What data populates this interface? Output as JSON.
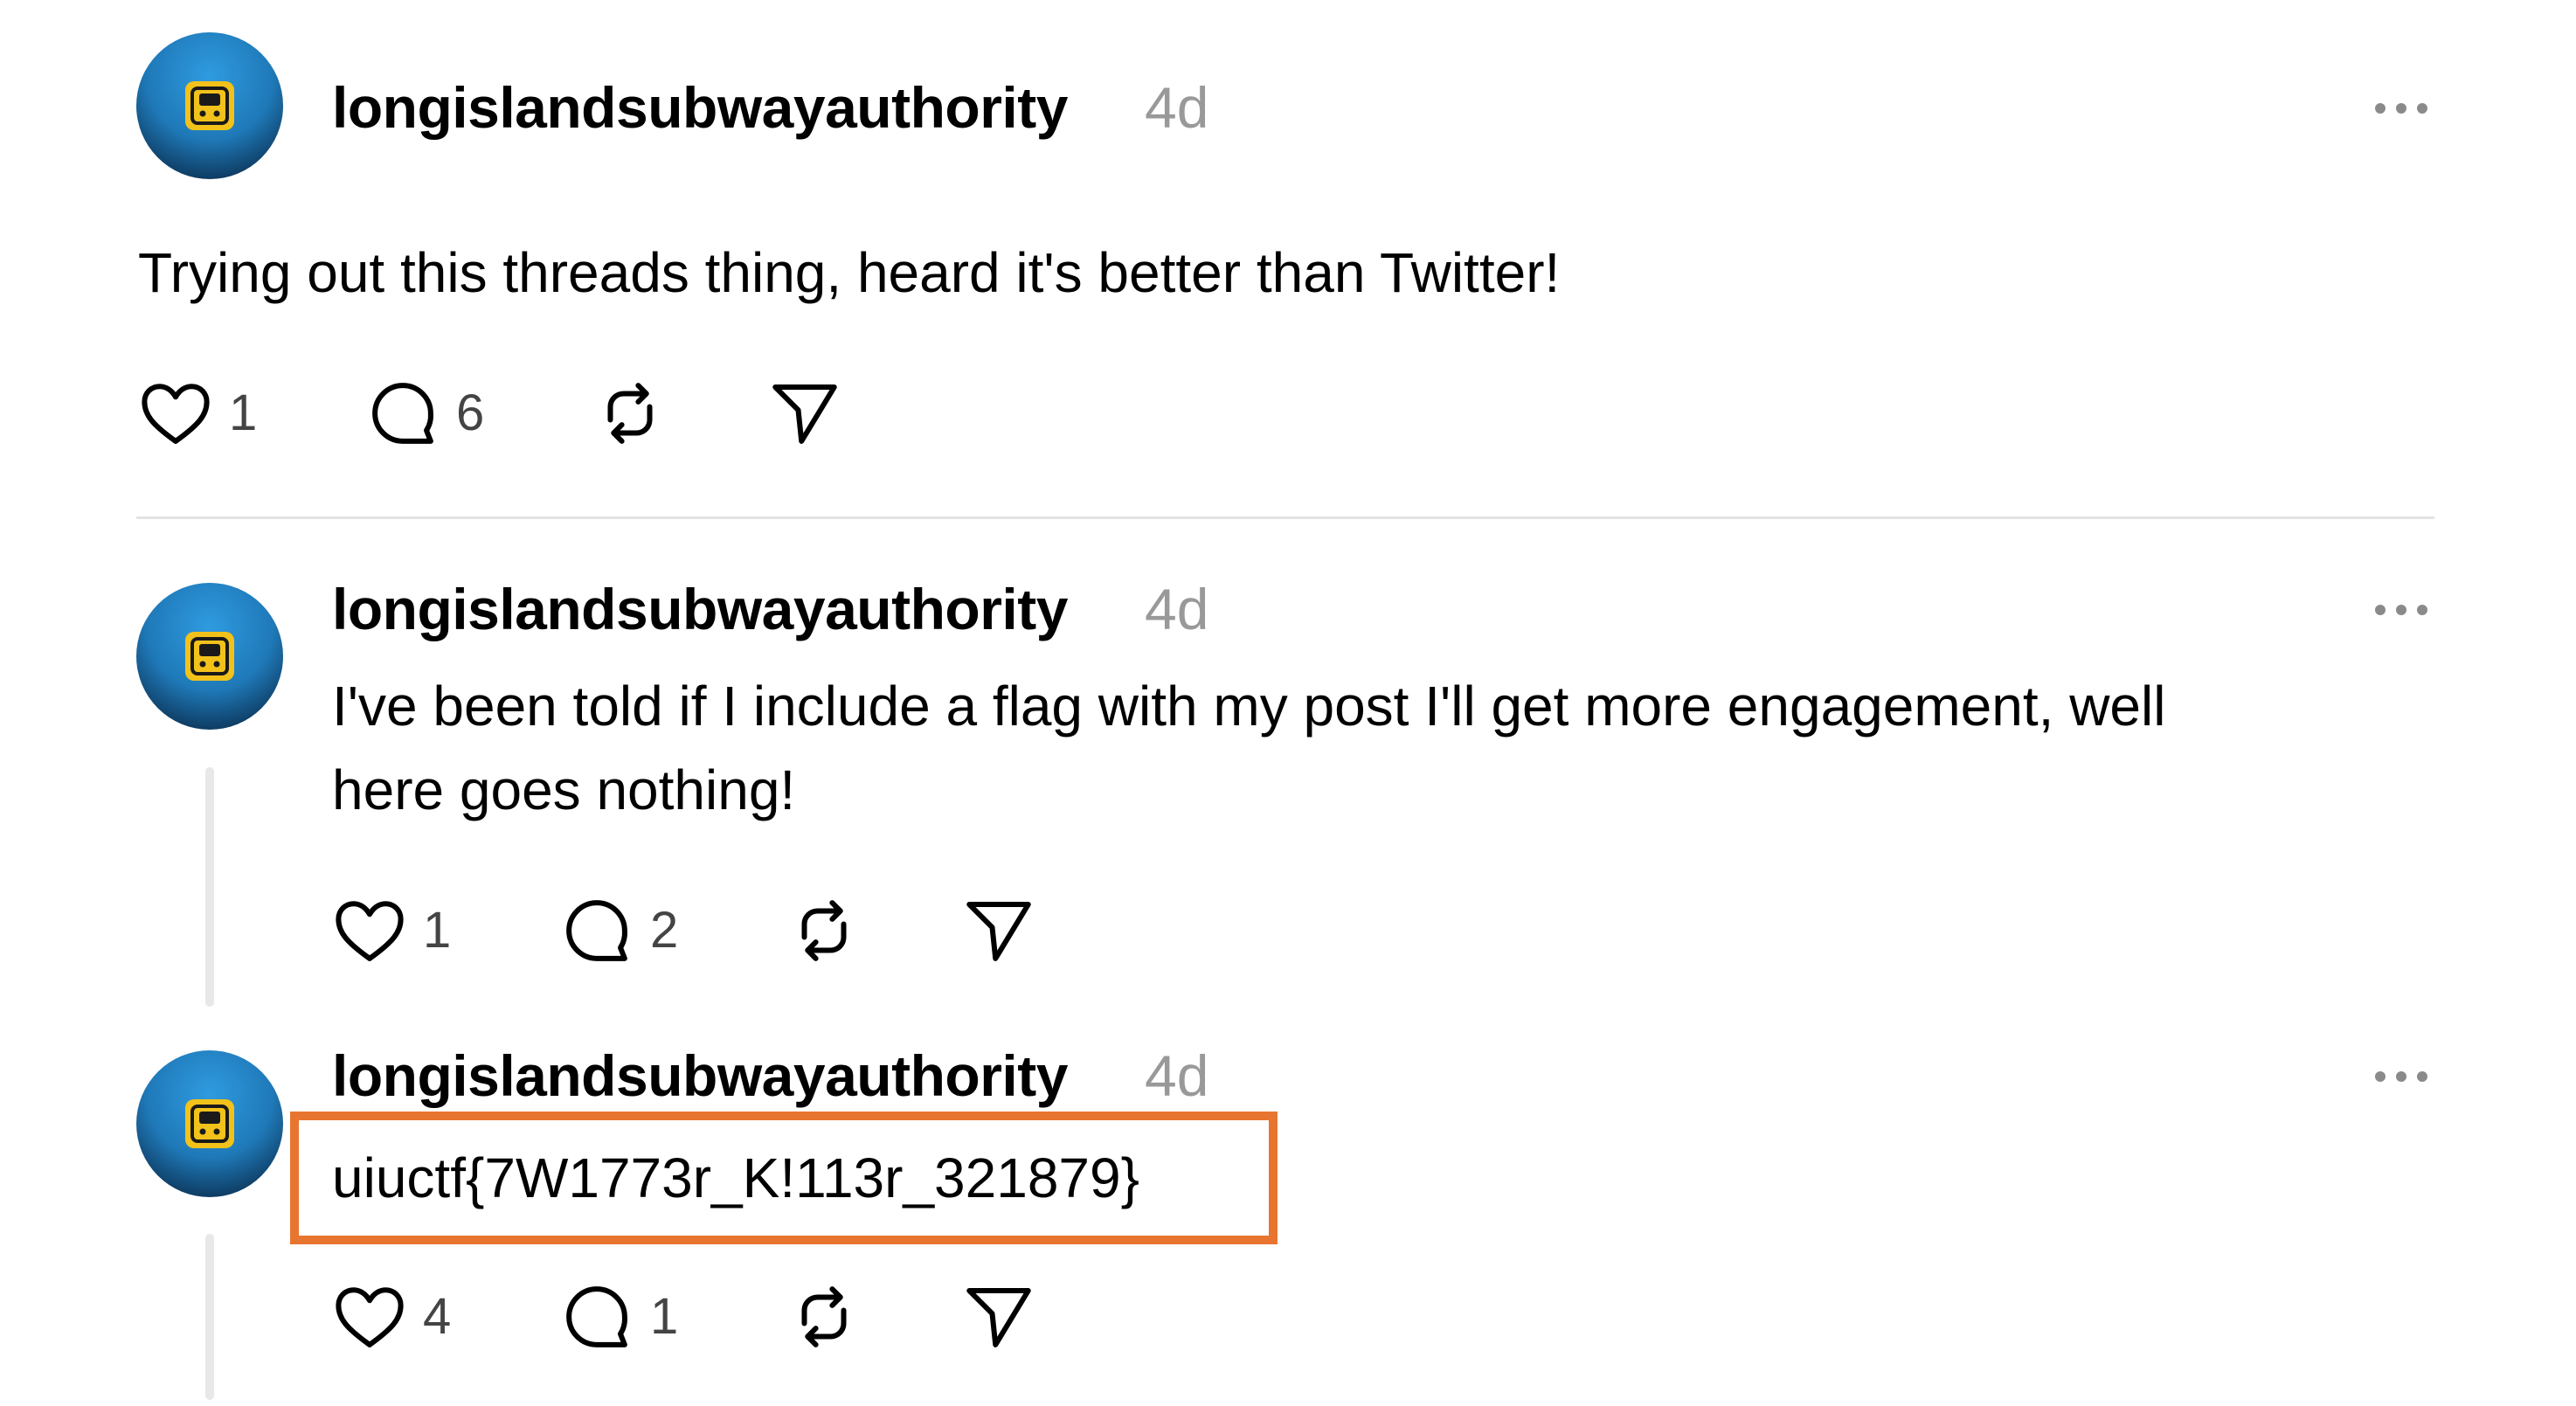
{
  "posts": [
    {
      "username": "longislandsubwayauthority",
      "time": "4d",
      "text_lines": [
        "Trying out this threads thing, heard it's better than Twitter!"
      ],
      "likes": "1",
      "replies": "6"
    },
    {
      "username": "longislandsubwayauthority",
      "time": "4d",
      "text_lines": [
        "I've been told if I include a flag with my post I'll get more engagement, well",
        "here goes nothing!"
      ],
      "likes": "1",
      "replies": "2"
    },
    {
      "username": "longislandsubwayauthority",
      "time": "4d",
      "text_lines": [
        "uiuctf{7W1773r_K!113r_321879}"
      ],
      "likes": "4",
      "replies": "1"
    }
  ],
  "icons": {
    "like": "heart-icon",
    "reply": "comment-icon",
    "repost": "repost-icon",
    "share": "send-icon",
    "more": "more-options-icon"
  },
  "colors": {
    "highlight_box": "#e8752f",
    "avatar": "#1f79b8",
    "timestamp": "#999999"
  }
}
